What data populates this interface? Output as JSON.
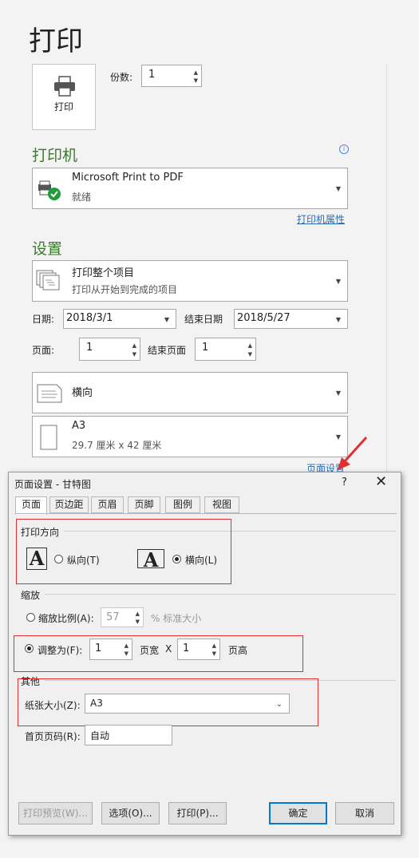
{
  "page_title": "打印",
  "print_button": {
    "label": "打印"
  },
  "copies": {
    "label": "份数:",
    "value": "1"
  },
  "printer": {
    "section_title": "打印机",
    "name": "Microsoft Print to PDF",
    "status": "就绪",
    "properties_link": "打印机属性"
  },
  "settings": {
    "section_title": "设置",
    "scope": {
      "title": "打印整个项目",
      "subtitle": "打印从开始到完成的项目"
    },
    "date_label": "日期:",
    "date_value": "2018/3/1",
    "end_date_label": "结束日期",
    "end_date_value": "2018/5/27",
    "page_label": "页面:",
    "page_value": "1",
    "end_page_label": "结束页面",
    "end_page_value": "1",
    "orientation": "横向",
    "paper": {
      "name": "A3",
      "size": "29.7 厘米 x 42 厘米"
    },
    "page_setup_link": "页面设置"
  },
  "dialog": {
    "title": "页面设置 - 甘特图",
    "help": "?",
    "close": "✕",
    "tabs": [
      "页面",
      "页边距",
      "页眉",
      "页脚",
      "图例",
      "视图"
    ],
    "orientation_group": "打印方向",
    "portrait": "纵向(T)",
    "landscape": "横向(L)",
    "scaling_group": "缩放",
    "adjust_to": "缩放比例(A):",
    "adjust_value": "57",
    "adjust_suffix": "% 标准大小",
    "fit_to": "调整为(F):",
    "fit_wide_value": "1",
    "fit_wide_label": "页宽",
    "fit_x": "X",
    "fit_tall_value": "1",
    "fit_tall_label": "页高",
    "other_group": "其他",
    "paper_size_label": "纸张大小(Z):",
    "paper_size_value": "A3",
    "first_page_label": "首页页码(R):",
    "first_page_value": "自动",
    "buttons": {
      "preview": "打印预览(W)...",
      "options": "选项(O)...",
      "print": "打印(P)...",
      "ok": "确定",
      "cancel": "取消"
    }
  },
  "colors": {
    "section_green": "#3c7a2e",
    "highlight_red": "#e03030",
    "link_blue": "#2b6cb0",
    "focus_blue": "#0078d7"
  }
}
